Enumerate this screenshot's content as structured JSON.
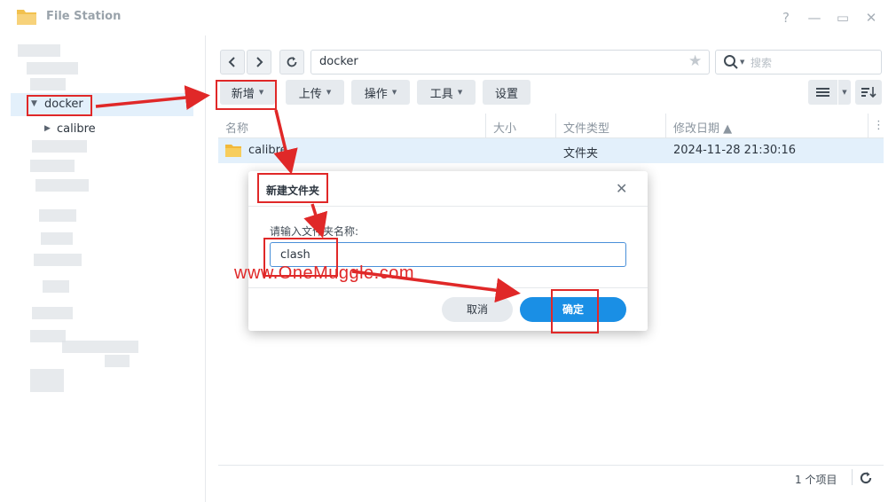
{
  "app": {
    "title": "File Station",
    "window_buttons": {
      "help": "?",
      "minimize": "—",
      "maximize": "▭",
      "close": "✕"
    }
  },
  "tree": {
    "items": [
      {
        "label": "docker",
        "caret": "▼",
        "selected": true
      },
      {
        "label": "calibre",
        "caret": "▶",
        "selected": false
      }
    ]
  },
  "toolbar": {
    "path": "docker",
    "search_placeholder": "搜索",
    "buttons": [
      {
        "label": "新增",
        "has_dropdown": true
      },
      {
        "label": "上传",
        "has_dropdown": true
      },
      {
        "label": "操作",
        "has_dropdown": true
      },
      {
        "label": "工具",
        "has_dropdown": true
      },
      {
        "label": "设置",
        "has_dropdown": false
      }
    ],
    "caret": "▼"
  },
  "list": {
    "columns": [
      "名称",
      "大小",
      "文件类型",
      "修改日期 ▲"
    ],
    "rows": [
      {
        "name": "calibre",
        "size": "",
        "type": "文件夹",
        "modified": "2024-11-28 21:30:16"
      }
    ],
    "item_count": "1 个项目",
    "more_icon": "⋮"
  },
  "dialog": {
    "title": "新建文件夹",
    "close": "✕",
    "prompt": "请输入文件夹名称:",
    "input_value": "clash",
    "cancel_label": "取消",
    "ok_label": "确定"
  },
  "annotation": {
    "watermark": "www.OneMuggle.com",
    "color": "#e02828"
  },
  "colors": {
    "accent": "#1a8fe5",
    "selected_row": "#e3f0fb",
    "button_bg": "#e6eaee"
  }
}
